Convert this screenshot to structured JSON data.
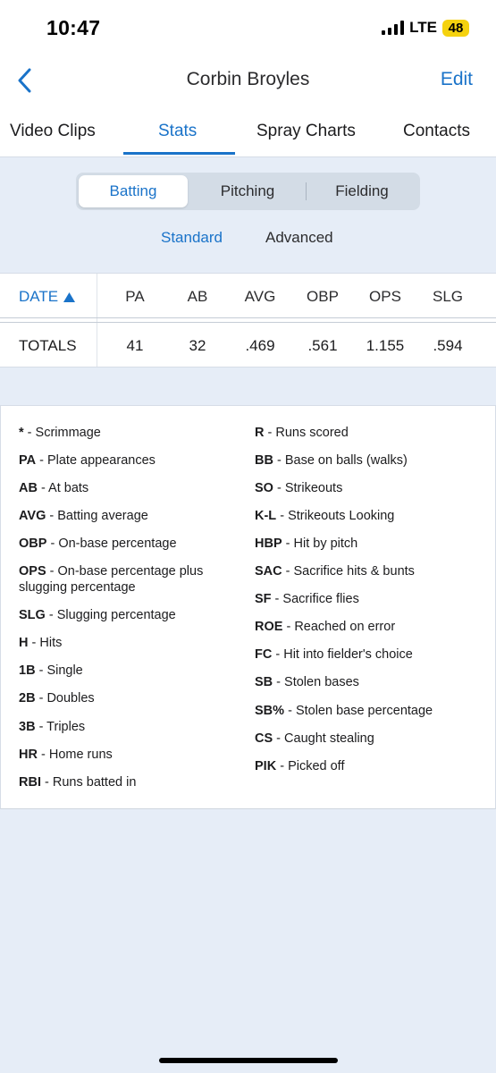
{
  "status_bar": {
    "time": "10:47",
    "network": "LTE",
    "battery": "48"
  },
  "nav": {
    "title": "Corbin Broyles",
    "edit_label": "Edit"
  },
  "tabs": [
    {
      "label": "Video Clips",
      "active": false
    },
    {
      "label": "Stats",
      "active": true
    },
    {
      "label": "Spray Charts",
      "active": false
    },
    {
      "label": "Contacts",
      "active": false
    }
  ],
  "segment": {
    "items": [
      "Batting",
      "Pitching",
      "Fielding"
    ],
    "selected": "Batting"
  },
  "subtabs": {
    "items": [
      "Standard",
      "Advanced"
    ],
    "selected": "Standard"
  },
  "table": {
    "date_header": "DATE",
    "sort_direction": "ascending",
    "columns": [
      "PA",
      "AB",
      "AVG",
      "OBP",
      "OPS",
      "SLG"
    ],
    "totals_label": "TOTALS",
    "totals": [
      "41",
      "32",
      ".469",
      ".561",
      "1.155",
      ".594"
    ]
  },
  "legend": {
    "left": [
      {
        "abbr": "*",
        "desc": "Scrimmage"
      },
      {
        "abbr": "PA",
        "desc": "Plate appearances"
      },
      {
        "abbr": "AB",
        "desc": "At bats"
      },
      {
        "abbr": "AVG",
        "desc": "Batting average"
      },
      {
        "abbr": "OBP",
        "desc": "On-base percentage"
      },
      {
        "abbr": "OPS",
        "desc": "On-base percentage plus slugging percentage"
      },
      {
        "abbr": "SLG",
        "desc": "Slugging percentage"
      },
      {
        "abbr": "H",
        "desc": "Hits"
      },
      {
        "abbr": "1B",
        "desc": "Single"
      },
      {
        "abbr": "2B",
        "desc": "Doubles"
      },
      {
        "abbr": "3B",
        "desc": "Triples"
      },
      {
        "abbr": "HR",
        "desc": "Home runs"
      },
      {
        "abbr": "RBI",
        "desc": "Runs batted in"
      }
    ],
    "right": [
      {
        "abbr": "R",
        "desc": "Runs scored"
      },
      {
        "abbr": "BB",
        "desc": "Base on balls (walks)"
      },
      {
        "abbr": "SO",
        "desc": "Strikeouts"
      },
      {
        "abbr": "K-L",
        "desc": "Strikeouts Looking"
      },
      {
        "abbr": "HBP",
        "desc": "Hit by pitch"
      },
      {
        "abbr": "SAC",
        "desc": "Sacrifice hits & bunts"
      },
      {
        "abbr": "SF",
        "desc": "Sacrifice flies"
      },
      {
        "abbr": "ROE",
        "desc": "Reached on error"
      },
      {
        "abbr": "FC",
        "desc": "Hit into fielder's choice"
      },
      {
        "abbr": "SB",
        "desc": "Stolen bases"
      },
      {
        "abbr": "SB%",
        "desc": "Stolen base percentage"
      },
      {
        "abbr": "CS",
        "desc": "Caught stealing"
      },
      {
        "abbr": "PIK",
        "desc": "Picked off"
      }
    ]
  },
  "colors": {
    "accent": "#1a73c9",
    "background": "#e6edf7",
    "battery": "#f5d20f"
  }
}
